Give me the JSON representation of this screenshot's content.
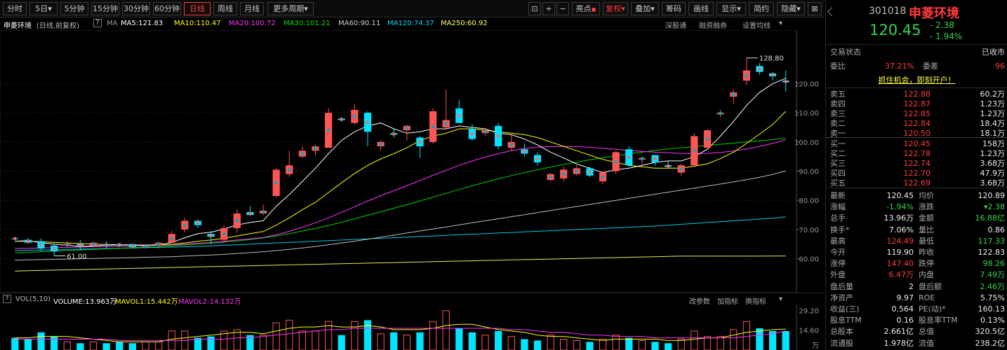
{
  "toolbar": {
    "periods": [
      "分时",
      "5日",
      "5分钟",
      "15分钟",
      "30分钟",
      "60分钟",
      "日线",
      "周线",
      "月线",
      "更多周期"
    ],
    "active_period": "日线",
    "tools": [
      "亮点",
      "复权",
      "叠加",
      "筹码",
      "画线",
      "显示",
      "简约",
      "隐藏"
    ],
    "active_tool": "复权"
  },
  "stock": {
    "code": "301018",
    "name": "申菱环境",
    "price": "120.45",
    "change": "- 2.38",
    "change_pct": "- 1.94%"
  },
  "indicator_bar": {
    "name": "申菱环境",
    "mode": "(日线,前复权)",
    "help": "?",
    "ma_label": "MA",
    "ma": [
      {
        "label": "MA5:121.83",
        "color": "#ffffff"
      },
      {
        "label": "MA10:110.47",
        "color": "#ffff00"
      },
      {
        "label": "MA20:100.72",
        "color": "#ff33ff"
      },
      {
        "label": "MA30:101.21",
        "color": "#00e000"
      },
      {
        "label": "MA60:90.11",
        "color": "#d0d0d0"
      },
      {
        "label": "MA120:74.37",
        "color": "#00d8ff"
      },
      {
        "label": "MA250:60.92",
        "color": "#ffff66"
      }
    ],
    "links": [
      "深股通",
      "融资融券",
      "设置均线"
    ]
  },
  "chart_data": {
    "type": "candlestick",
    "y_ticks": [
      "120.00",
      "110.00",
      "100.00",
      "90.00",
      "80.00",
      "70.00",
      "60.00"
    ],
    "ylim": [
      52,
      134
    ],
    "annotations": {
      "high": "128.80",
      "low": "61.00"
    },
    "candles": [
      [
        67.0,
        67.5,
        66.5,
        66.8
      ],
      [
        66.5,
        67.2,
        65.0,
        65.5
      ],
      [
        66.0,
        67.0,
        62.5,
        63.5
      ],
      [
        64.5,
        65.0,
        61.0,
        62.5
      ],
      [
        64.5,
        66.0,
        64.0,
        65.0
      ],
      [
        65.0,
        66.5,
        63.0,
        64.5
      ],
      [
        64.5,
        66.0,
        64.0,
        65.5
      ],
      [
        65.0,
        66.0,
        63.5,
        64.5
      ],
      [
        65.0,
        65.5,
        64.0,
        64.5
      ],
      [
        65.0,
        65.3,
        63.5,
        64.0
      ],
      [
        64.0,
        65.0,
        63.5,
        64.3
      ],
      [
        64.5,
        66.0,
        63.5,
        65.5
      ],
      [
        65.5,
        69.5,
        65.5,
        68.5
      ],
      [
        70.0,
        74.0,
        69.0,
        73.0
      ],
      [
        73.0,
        73.5,
        70.5,
        71.5
      ],
      [
        68.5,
        69.5,
        65.0,
        67.5
      ],
      [
        66.5,
        71.5,
        65.5,
        70.5
      ],
      [
        70.5,
        77.0,
        69.0,
        75.5
      ],
      [
        76.0,
        78.0,
        74.5,
        75.0
      ],
      [
        75.5,
        78.5,
        75.0,
        76.5
      ],
      [
        81.5,
        91.0,
        81.0,
        90.5
      ],
      [
        89.0,
        97.0,
        88.0,
        92.0
      ],
      [
        95.0,
        98.5,
        94.5,
        97.0
      ],
      [
        97.0,
        99.0,
        95.5,
        98.5
      ],
      [
        98.0,
        111.5,
        98.0,
        110.0
      ],
      [
        108.0,
        108.5,
        107.0,
        107.5
      ],
      [
        106.5,
        113.0,
        106.0,
        111.0
      ],
      [
        110.0,
        110.5,
        98.5,
        103.5
      ],
      [
        98.5,
        100.5,
        97.0,
        100.0
      ],
      [
        103.0,
        104.5,
        101.5,
        102.5
      ],
      [
        104.0,
        106.0,
        100.5,
        105.5
      ],
      [
        101.5,
        102.0,
        94.5,
        98.5
      ],
      [
        100.0,
        111.5,
        99.5,
        110.5
      ],
      [
        105.0,
        118.0,
        104.0,
        107.5
      ],
      [
        111.5,
        114.5,
        106.5,
        106.5
      ],
      [
        104.5,
        106.0,
        100.5,
        101.0
      ],
      [
        103.0,
        104.5,
        102.0,
        104.0
      ],
      [
        105.5,
        106.5,
        97.5,
        98.5
      ],
      [
        98.0,
        102.5,
        97.0,
        100.0
      ],
      [
        97.5,
        99.5,
        95.0,
        96.0
      ],
      [
        95.5,
        96.5,
        92.0,
        93.0
      ],
      [
        87.0,
        89.5,
        86.5,
        89.0
      ],
      [
        87.5,
        91.5,
        86.5,
        90.5
      ],
      [
        89.0,
        92.0,
        88.5,
        91.0
      ],
      [
        91.0,
        91.5,
        88.0,
        88.5
      ],
      [
        86.5,
        90.0,
        85.5,
        89.5
      ],
      [
        90.0,
        97.0,
        89.0,
        96.5
      ],
      [
        97.5,
        98.5,
        91.5,
        92.0
      ],
      [
        94.0,
        95.0,
        92.0,
        94.5
      ],
      [
        95.5,
        95.5,
        92.0,
        93.0
      ],
      [
        92.0,
        93.5,
        91.0,
        91.5
      ],
      [
        89.5,
        92.5,
        88.5,
        92.0
      ],
      [
        92.0,
        103.0,
        91.5,
        102.0
      ],
      [
        98.0,
        104.5,
        98.0,
        104.0
      ],
      [
        109.5,
        111.0,
        108.5,
        110.0
      ],
      [
        115.5,
        118.0,
        113.0,
        117.0
      ],
      [
        121.0,
        128.8,
        119.5,
        124.5
      ],
      [
        126.0,
        127.0,
        123.0,
        124.0
      ],
      [
        123.5,
        124.0,
        121.0,
        122.5
      ],
      [
        121.0,
        124.5,
        117.3,
        120.45
      ]
    ],
    "ma5": [
      66.0,
      66.2,
      65.5,
      65.0,
      64.6,
      64.2,
      64.4,
      64.6,
      64.8,
      64.7,
      64.6,
      64.9,
      65.5,
      67.2,
      68.6,
      69.1,
      70.2,
      71.6,
      72.4,
      73.0,
      78.0,
      82.0,
      86.5,
      91.0,
      96.0,
      100.5,
      103.5,
      105.5,
      106.5,
      104.5,
      103.0,
      103.5,
      104.5,
      104.5,
      105.5,
      105.0,
      104.5,
      103.0,
      102.5,
      101.0,
      99.0,
      96.5,
      94.5,
      92.5,
      91.0,
      89.5,
      90.5,
      91.0,
      92.0,
      93.0,
      93.5,
      93.5,
      95.0,
      97.5,
      102.0,
      107.0,
      112.5,
      117.0,
      120.0,
      121.83
    ],
    "ma10": [
      66.0,
      66.0,
      65.8,
      65.6,
      65.4,
      65.2,
      65.0,
      64.9,
      64.8,
      64.7,
      64.7,
      64.7,
      64.9,
      65.4,
      66.0,
      66.4,
      67.0,
      67.8,
      68.6,
      69.3,
      71.5,
      74.0,
      76.8,
      79.3,
      82.7,
      86.0,
      89.2,
      92.0,
      94.2,
      96.0,
      98.0,
      100.5,
      102.0,
      103.0,
      104.5,
      104.5,
      104.0,
      103.5,
      103.0,
      102.5,
      101.5,
      100.0,
      98.5,
      97.0,
      95.5,
      94.0,
      93.0,
      92.0,
      91.5,
      91.0,
      91.0,
      91.0,
      91.7,
      92.5,
      94.3,
      96.5,
      99.5,
      102.7,
      106.0,
      110.47
    ],
    "ma20": [
      63.5,
      63.6,
      63.7,
      63.8,
      63.9,
      64.0,
      64.1,
      64.2,
      64.3,
      64.4,
      64.5,
      64.6,
      64.8,
      65.0,
      65.3,
      65.6,
      66.0,
      66.4,
      66.8,
      67.3,
      68.2,
      69.4,
      70.8,
      72.3,
      74.0,
      75.9,
      77.8,
      79.8,
      81.6,
      83.3,
      85.0,
      86.8,
      88.6,
      90.3,
      92.0,
      93.5,
      94.8,
      96.0,
      97.0,
      97.8,
      98.2,
      98.4,
      98.5,
      98.4,
      98.2,
      97.8,
      97.5,
      97.1,
      96.8,
      96.5,
      96.3,
      96.1,
      96.0,
      96.1,
      96.4,
      96.9,
      97.6,
      98.5,
      99.5,
      100.72
    ],
    "ma30": [
      62.0,
      62.2,
      62.4,
      62.6,
      62.8,
      63.0,
      63.2,
      63.4,
      63.6,
      63.8,
      64.0,
      64.2,
      64.4,
      64.7,
      65.0,
      65.3,
      65.7,
      66.1,
      66.6,
      67.1,
      67.8,
      68.6,
      69.5,
      70.4,
      71.4,
      72.5,
      73.7,
      74.9,
      76.1,
      77.3,
      78.5,
      79.8,
      81.1,
      82.4,
      83.7,
      85.0,
      86.2,
      87.4,
      88.5,
      89.5,
      90.5,
      91.4,
      92.3,
      93.1,
      93.9,
      94.6,
      95.3,
      95.9,
      96.5,
      97.1,
      97.6,
      98.0,
      98.4,
      98.8,
      99.2,
      99.6,
      100.0,
      100.4,
      100.8,
      101.21
    ],
    "ma60": [
      59.5,
      59.6,
      59.7,
      59.8,
      59.9,
      60.0,
      60.1,
      60.2,
      60.3,
      60.4,
      60.5,
      60.6,
      60.7,
      60.9,
      61.1,
      61.3,
      61.5,
      61.8,
      62.1,
      62.4,
      62.8,
      63.2,
      63.7,
      64.2,
      64.8,
      65.4,
      66.0,
      66.7,
      67.4,
      68.1,
      68.8,
      69.5,
      70.2,
      70.9,
      71.6,
      72.3,
      73.0,
      73.7,
      74.4,
      75.1,
      75.8,
      76.5,
      77.2,
      77.9,
      78.6,
      79.3,
      80.0,
      80.7,
      81.4,
      82.1,
      82.8,
      83.5,
      84.2,
      84.9,
      85.6,
      86.3,
      87.1,
      87.9,
      88.9,
      90.11
    ],
    "ma120": [
      62.8,
      62.9,
      63.0,
      63.1,
      63.2,
      63.3,
      63.4,
      63.5,
      63.6,
      63.7,
      63.8,
      63.9,
      64.0,
      64.1,
      64.2,
      64.4,
      64.6,
      64.8,
      65.0,
      65.2,
      65.4,
      65.6,
      65.8,
      66.0,
      66.2,
      66.4,
      66.6,
      66.8,
      67.0,
      67.2,
      67.4,
      67.6,
      67.8,
      68.0,
      68.2,
      68.4,
      68.6,
      68.8,
      69.0,
      69.2,
      69.4,
      69.6,
      69.8,
      70.0,
      70.2,
      70.4,
      70.6,
      70.8,
      71.0,
      71.2,
      71.5,
      71.8,
      72.1,
      72.4,
      72.7,
      73.0,
      73.3,
      73.6,
      73.9,
      74.37
    ],
    "ma250": [
      55.8,
      55.9,
      56.0,
      56.1,
      56.2,
      56.3,
      56.4,
      56.5,
      56.6,
      56.7,
      56.8,
      56.9,
      57.0,
      57.1,
      57.2,
      57.3,
      57.4,
      57.5,
      57.6,
      57.7,
      57.8,
      57.9,
      58.0,
      58.1,
      58.2,
      58.3,
      58.4,
      58.5,
      58.6,
      58.7,
      58.8,
      58.9,
      59.0,
      59.1,
      59.2,
      59.3,
      59.4,
      59.5,
      59.6,
      59.7,
      59.8,
      59.9,
      60.0,
      60.1,
      60.2,
      60.3,
      60.4,
      60.5,
      60.6,
      60.7,
      60.8,
      60.9,
      60.9,
      60.9,
      60.9,
      60.9,
      60.9,
      60.9,
      60.92,
      60.92
    ],
    "volume": {
      "ylim": [
        0,
        32
      ],
      "y_ticks": [
        "29.20",
        "14.60",
        "万"
      ],
      "values": [
        9,
        8,
        13,
        10,
        6,
        5,
        6,
        5,
        6,
        5,
        6,
        6,
        14,
        14,
        9,
        10,
        14,
        15,
        11,
        11,
        20,
        22,
        14,
        14,
        21,
        11,
        21,
        22,
        12,
        13,
        11,
        13,
        21,
        29,
        16,
        13,
        11,
        14,
        10,
        8,
        7,
        11,
        8,
        7,
        6,
        8,
        11,
        9,
        7,
        6,
        5,
        8,
        14,
        10,
        10,
        15,
        21,
        16,
        14,
        13.96
      ],
      "mavol1": [
        9,
        9,
        10,
        10,
        10,
        9,
        8,
        7,
        6,
        6,
        6,
        6,
        8,
        9,
        10,
        11,
        12,
        13,
        13,
        12,
        14,
        16,
        17,
        17,
        18,
        17,
        17,
        18,
        17,
        15,
        15,
        15,
        16,
        18,
        19,
        19,
        17,
        15,
        14,
        13,
        11,
        10,
        10,
        9,
        8,
        7,
        8,
        8,
        8,
        8,
        7,
        7,
        8,
        9,
        9,
        11,
        13,
        14,
        15,
        15.44
      ],
      "mavol2": [
        8,
        8,
        8,
        8,
        8,
        8,
        8,
        8,
        7,
        7,
        7,
        7,
        7,
        7,
        8,
        8,
        8,
        9,
        9,
        10,
        11,
        12,
        13,
        14,
        15,
        15,
        16,
        16,
        16,
        16,
        16,
        16,
        16,
        16,
        16,
        16,
        16,
        16,
        15,
        15,
        14,
        13,
        13,
        12,
        11,
        11,
        10,
        10,
        10,
        9,
        9,
        9,
        9,
        9,
        9,
        9,
        10,
        11,
        12,
        14.13
      ]
    }
  },
  "volume_bar": {
    "label": "VOL(5,10)",
    "volume": "VOLUME:13.963万",
    "mavol1": "MAVOL1:15.442万",
    "mavol2": "MAVOL2:14.132万",
    "links": [
      "改参数",
      "加指标",
      "换指标"
    ]
  },
  "quote": {
    "status_label": "交易状态",
    "status_value": "已收市",
    "weibi_label": "委比",
    "weibi": "37.21%",
    "weicha_label": "委差",
    "weicha": "96",
    "promo": "抓住机会，即刻开户！",
    "sells": [
      {
        "label": "卖五",
        "price": "122.88",
        "vol": "60.2万"
      },
      {
        "label": "卖四",
        "price": "122.87",
        "vol": "1.23万"
      },
      {
        "label": "卖三",
        "price": "122.85",
        "vol": "1.23万"
      },
      {
        "label": "卖二",
        "price": "122.84",
        "vol": "18.4万"
      },
      {
        "label": "卖一",
        "price": "120.50",
        "vol": "18.1万"
      }
    ],
    "buys": [
      {
        "label": "买一",
        "price": "120.45",
        "vol": "158万"
      },
      {
        "label": "买二",
        "price": "122.78",
        "vol": "1.23万"
      },
      {
        "label": "买三",
        "price": "122.74",
        "vol": "3.68万"
      },
      {
        "label": "买四",
        "price": "122.70",
        "vol": "47.9万"
      },
      {
        "label": "买五",
        "price": "122.69",
        "vol": "3.68万"
      }
    ],
    "stats": [
      [
        "最新",
        "120.45",
        "均价",
        "120.89"
      ],
      [
        "涨幅",
        "-1.94%",
        "涨跌",
        "▾2.38"
      ],
      [
        "总手",
        "13.96万",
        "金额",
        "16.88亿"
      ],
      [
        "换手*",
        "7.06%",
        "量比",
        "0.86"
      ],
      [
        "最高",
        "124.49",
        "最低",
        "117.33"
      ],
      [
        "今开",
        "119.90",
        "昨收",
        "122.83"
      ],
      [
        "涨停",
        "147.40",
        "跌停",
        "98.26"
      ],
      [
        "外盘",
        "6.47万",
        "内盘",
        "7.49万"
      ],
      [
        "盘后量",
        "2",
        "盘后额",
        "2.46万"
      ],
      [
        "净资产",
        "9.97",
        "ROE",
        "5.75%"
      ],
      [
        "收益(三)",
        "0.564",
        "PE(动)*",
        "160.13"
      ],
      [
        "股息TTM",
        "0.16",
        "股息率TTM",
        "0.13%"
      ],
      [
        "总股本",
        "2.661亿",
        "总值",
        "320.5亿"
      ],
      [
        "流通股",
        "1.978亿",
        "流值",
        "238.2亿"
      ]
    ]
  }
}
